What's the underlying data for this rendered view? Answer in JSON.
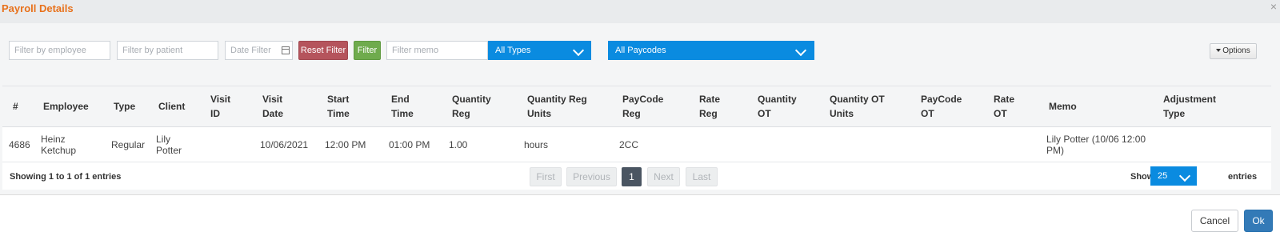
{
  "dialog": {
    "title": "Payroll Details",
    "close_glyph": "×"
  },
  "filters": {
    "employee_placeholder": "Filter by employee",
    "patient_placeholder": "Filter by patient",
    "date_placeholder": "Date Filter",
    "reset_label": "Reset Filter",
    "filter_label": "Filter",
    "memo_placeholder": "Filter memo",
    "types_value": "All Types",
    "paycodes_value": "All Paycodes",
    "options_label": "Options"
  },
  "table": {
    "headers": [
      {
        "l1": "#",
        "l2": ""
      },
      {
        "l1": "Employee",
        "l2": ""
      },
      {
        "l1": "Type",
        "l2": ""
      },
      {
        "l1": "Client",
        "l2": ""
      },
      {
        "l1": "Visit",
        "l2": "ID"
      },
      {
        "l1": "Visit",
        "l2": "Date"
      },
      {
        "l1": "Start",
        "l2": "Time"
      },
      {
        "l1": "End",
        "l2": "Time"
      },
      {
        "l1": "Quantity",
        "l2": "Reg"
      },
      {
        "l1": "Quantity Reg",
        "l2": "Units"
      },
      {
        "l1": "PayCode",
        "l2": "Reg"
      },
      {
        "l1": "Rate",
        "l2": "Reg"
      },
      {
        "l1": "Quantity",
        "l2": "OT"
      },
      {
        "l1": "Quantity OT",
        "l2": "Units"
      },
      {
        "l1": "PayCode",
        "l2": "OT"
      },
      {
        "l1": "Rate",
        "l2": "OT"
      },
      {
        "l1": "Memo",
        "l2": ""
      },
      {
        "l1": "Adjustment",
        "l2": "Type"
      }
    ],
    "rows": [
      {
        "id": "4686",
        "employee_1": "Heinz",
        "employee_2": "Ketchup",
        "type": "Regular",
        "client_1": "Lily",
        "client_2": "Potter",
        "visit_id": "",
        "visit_date": "10/06/2021",
        "start_time": "12:00 PM",
        "end_time": "01:00 PM",
        "quantity_reg": "1.00",
        "quantity_reg_units": "hours",
        "paycode_reg": "2CC",
        "rate_reg": "",
        "quantity_ot": "",
        "quantity_ot_units": "",
        "paycode_ot": "",
        "rate_ot": "",
        "memo_1": "Lily Potter (10/06 12:00",
        "memo_2": "PM)",
        "adjustment_type": ""
      }
    ]
  },
  "pagination": {
    "info": "Showing 1 to 1 of 1 entries",
    "first": "First",
    "previous": "Previous",
    "current": "1",
    "next": "Next",
    "last": "Last",
    "show_label": "Show",
    "page_size": "25",
    "entries_label": "entries"
  },
  "actions": {
    "cancel": "Cancel",
    "ok": "Ok"
  },
  "colors": {
    "title": "#e8711b",
    "select_blue": "#0a8be0",
    "reset_button": "#b5545c",
    "filter_button": "#6fab4d",
    "ok_button": "#337ab7",
    "active_page": "#4a5562"
  }
}
